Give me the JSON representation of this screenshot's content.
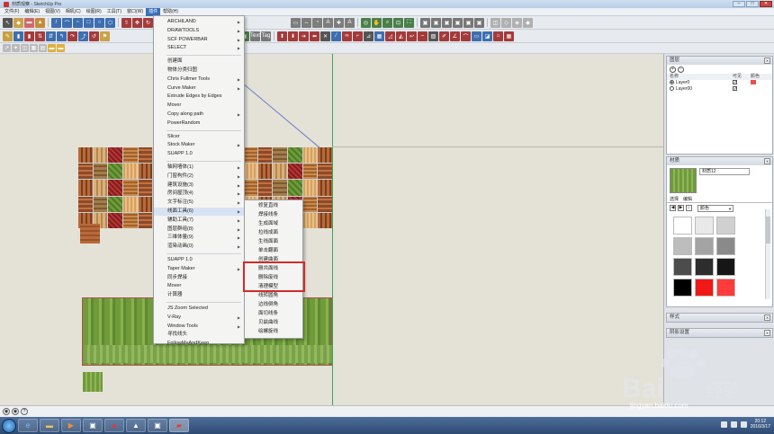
{
  "window": {
    "title": "材质观察 - SketchUp Pro"
  },
  "menubar": {
    "items": [
      "文件(F)",
      "编辑(E)",
      "视图(V)",
      "相机(C)",
      "绘图(R)",
      "工具(T)",
      "窗口(W)",
      "插件",
      "帮助(H)"
    ],
    "active": "插件"
  },
  "toolbar": {
    "row3_label_a": "Text",
    "row3_label_b": "Tag",
    "row3_s_label": "S~",
    "row3_s2_label": "S~"
  },
  "plugins_menu": {
    "items": [
      {
        "label": "ARCHILAND",
        "sub": true
      },
      {
        "label": "DRAWTOOLS",
        "sub": true
      },
      {
        "label": "SCF POWERBAR",
        "sub": true
      },
      {
        "label": "SELECT",
        "sub": true
      },
      {
        "sep": true
      },
      {
        "label": "创建面"
      },
      {
        "label": "物体分类归图"
      },
      {
        "label": "Chris Fullmer Tools",
        "sub": true
      },
      {
        "label": "Curve Maker",
        "sub": true
      },
      {
        "label": "Extrude Edges by Edges"
      },
      {
        "label": "Mover"
      },
      {
        "label": "Copy along path",
        "sub": true
      },
      {
        "label": "PowerRandom"
      },
      {
        "sep": true
      },
      {
        "label": "Slicer"
      },
      {
        "label": "Stock Maker",
        "sub": true
      },
      {
        "label": "SUAPP 1.0"
      },
      {
        "sep": true
      },
      {
        "label": "轴网墙体(1)",
        "sub": true
      },
      {
        "label": "门窗构件(2)",
        "sub": true
      },
      {
        "label": "建筑设施(3)",
        "sub": true
      },
      {
        "label": "房间屋顶(4)",
        "sub": true
      },
      {
        "label": "文字标注(5)",
        "sub": true
      },
      {
        "label": "线面工具(6)",
        "sub": true,
        "highlight": true
      },
      {
        "label": "辅助工具(7)",
        "sub": true
      },
      {
        "label": "图层群组(8)",
        "sub": true
      },
      {
        "label": "三维体量(9)",
        "sub": true
      },
      {
        "label": "渲染动画(0)",
        "sub": true
      },
      {
        "sep": true
      },
      {
        "label": "SUAPP 1.0"
      },
      {
        "label": "Taper Maker",
        "sub": true
      },
      {
        "label": "同步焊接"
      },
      {
        "label": "Mover"
      },
      {
        "label": "计算器"
      },
      {
        "sep": true
      },
      {
        "label": "JS Zoom Selected"
      },
      {
        "label": "V-Ray",
        "sub": true
      },
      {
        "label": "Window Tools",
        "sub": true
      },
      {
        "label": "寻找线头"
      },
      {
        "label": "FollowMeAndKeep"
      }
    ]
  },
  "submenu": {
    "items": [
      "修复直线",
      "焊接线条",
      "生成面域",
      "拉线成面",
      "生线面面",
      "单击翻面",
      "创建曲面",
      "删共面线",
      "删除废线",
      "清理模型",
      "线转圆角",
      "边线倒角",
      "面切线条",
      "贝兹曲线",
      "绘螺旋线"
    ],
    "highlighted": [
      "删共面线",
      "删除废线",
      "清理模型"
    ]
  },
  "layers_panel": {
    "title": "图层",
    "columns": [
      "名称",
      "可见",
      "颜色"
    ],
    "rows": [
      {
        "name": "Layer0",
        "visible": true,
        "active": true,
        "color": "#e85050"
      },
      {
        "name": "Layer00",
        "visible": true,
        "active": false,
        "color": "#ffffff"
      }
    ]
  },
  "materials_panel": {
    "title": "材质",
    "material_name": "材质12",
    "tabs": [
      "选择",
      "编辑"
    ],
    "library": "颜色",
    "swatches": [
      "#ffffff",
      "#e9e9e9",
      "#d0d0d0",
      "#bdbdbd",
      "#a3a3a3",
      "#8a8a8a",
      "#4c4c4c",
      "#2d2d2d",
      "#161616",
      "#000000",
      "#f11818",
      "#ff3b3b"
    ]
  },
  "collapsed_panels": [
    "样式",
    "阴影设置"
  ],
  "taskbar": {
    "time": "20:12",
    "date": "2016/3/17"
  },
  "watermark": {
    "brand": "Bai 经验",
    "url": "jingyan.baidu.com"
  }
}
